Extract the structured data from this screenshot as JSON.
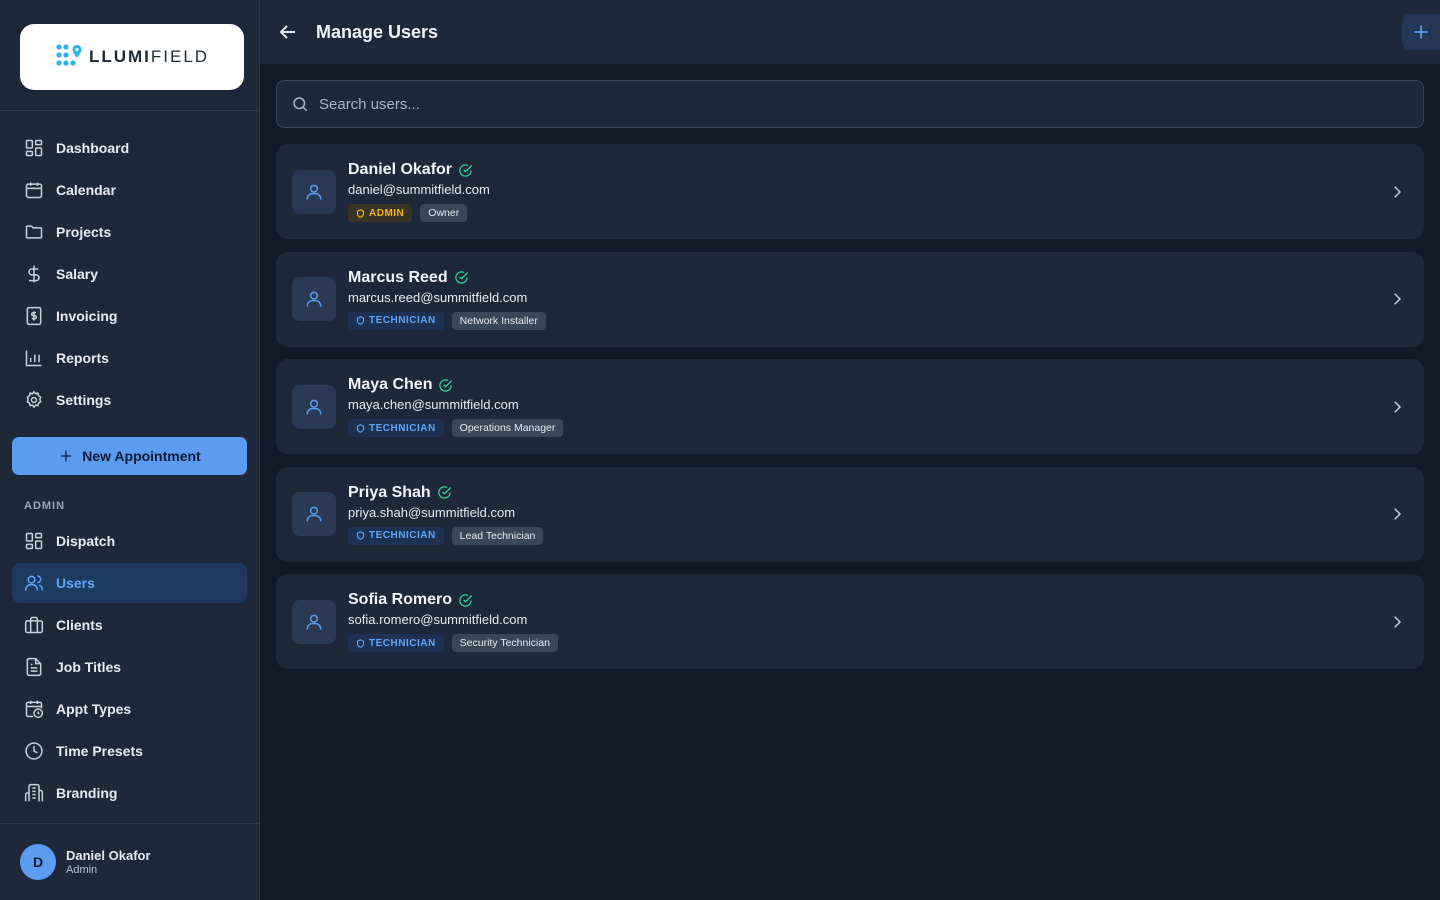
{
  "brand": {
    "name_bold": "LLUMI",
    "name_light": "FIELD",
    "accent": "#2bb3e8"
  },
  "sidebar": {
    "main_items": [
      {
        "label": "Dashboard",
        "icon": "grid-icon"
      },
      {
        "label": "Calendar",
        "icon": "calendar-icon"
      },
      {
        "label": "Projects",
        "icon": "folder-icon"
      },
      {
        "label": "Salary",
        "icon": "dollar-icon"
      },
      {
        "label": "Invoicing",
        "icon": "invoice-icon"
      },
      {
        "label": "Reports",
        "icon": "bar-chart-icon"
      },
      {
        "label": "Settings",
        "icon": "gear-icon"
      }
    ],
    "new_appointment_label": "New Appointment",
    "admin_section_label": "ADMIN",
    "admin_items": [
      {
        "label": "Dispatch",
        "icon": "grid-icon"
      },
      {
        "label": "Users",
        "icon": "users-icon",
        "active": true
      },
      {
        "label": "Clients",
        "icon": "briefcase-icon"
      },
      {
        "label": "Job Titles",
        "icon": "document-icon"
      },
      {
        "label": "Appt Types",
        "icon": "calendar-clock-icon"
      },
      {
        "label": "Time Presets",
        "icon": "clock-icon"
      },
      {
        "label": "Branding",
        "icon": "building-icon"
      }
    ],
    "footer": {
      "avatar_initial": "D",
      "name": "Daniel Okafor",
      "role": "Admin"
    }
  },
  "header": {
    "title": "Manage Users"
  },
  "search": {
    "placeholder": "Search users..."
  },
  "users": [
    {
      "name": "Daniel Okafor",
      "email": "daniel@summitfield.com",
      "role": "ADMIN",
      "role_type": "admin",
      "title": "Owner"
    },
    {
      "name": "Marcus Reed",
      "email": "marcus.reed@summitfield.com",
      "role": "TECHNICIAN",
      "role_type": "tech",
      "title": "Network Installer"
    },
    {
      "name": "Maya Chen",
      "email": "maya.chen@summitfield.com",
      "role": "TECHNICIAN",
      "role_type": "tech",
      "title": "Operations Manager"
    },
    {
      "name": "Priya Shah",
      "email": "priya.shah@summitfield.com",
      "role": "TECHNICIAN",
      "role_type": "tech",
      "title": "Lead Technician"
    },
    {
      "name": "Sofia Romero",
      "email": "sofia.romero@summitfield.com",
      "role": "TECHNICIAN",
      "role_type": "tech",
      "title": "Security Technician"
    }
  ],
  "colors": {
    "accent_blue": "#5b9cf0",
    "admin_badge": "#f5b50a",
    "tech_badge": "#60a5fa",
    "verified_green": "#34d399"
  }
}
